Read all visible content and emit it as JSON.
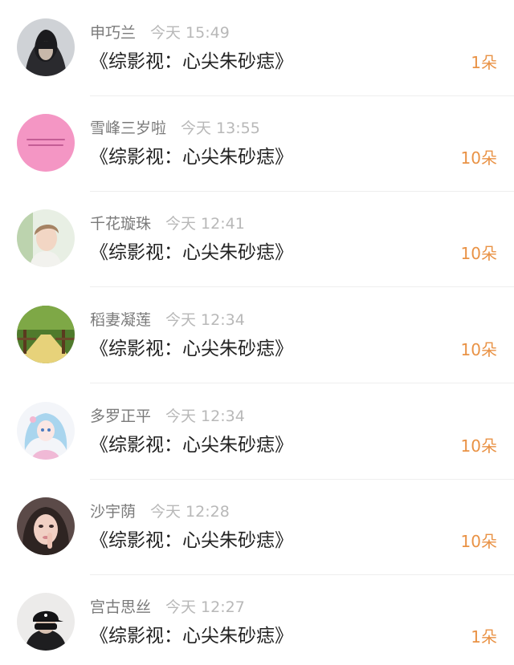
{
  "feed": {
    "items": [
      {
        "user": "申巧兰",
        "time": "今天 15:49",
        "title": "《综影视：心尖朱砂痣》",
        "gift": "1朵",
        "avatar": "avatar-hooded-figure"
      },
      {
        "user": "雪峰三岁啦",
        "time": "今天 13:55",
        "title": "《综影视：心尖朱砂痣》",
        "gift": "10朵",
        "avatar": "avatar-pink-text-card"
      },
      {
        "user": "千花璇珠",
        "time": "今天 12:41",
        "title": "《综影视：心尖朱砂痣》",
        "gift": "10朵",
        "avatar": "avatar-young-man"
      },
      {
        "user": "稻妻凝莲",
        "time": "今天 12:34",
        "title": "《综影视：心尖朱砂痣》",
        "gift": "10朵",
        "avatar": "avatar-forest-path"
      },
      {
        "user": "多罗正平",
        "time": "今天 12:34",
        "title": "《综影视：心尖朱砂痣》",
        "gift": "10朵",
        "avatar": "avatar-anime-girl"
      },
      {
        "user": "沙宇荫",
        "time": "今天 12:28",
        "title": "《综影视：心尖朱砂痣》",
        "gift": "10朵",
        "avatar": "avatar-girl-selfie"
      },
      {
        "user": "宫古思丝",
        "time": "今天 12:27",
        "title": "《综影视：心尖朱砂痣》",
        "gift": "1朵",
        "avatar": "avatar-cap-figure"
      }
    ]
  }
}
